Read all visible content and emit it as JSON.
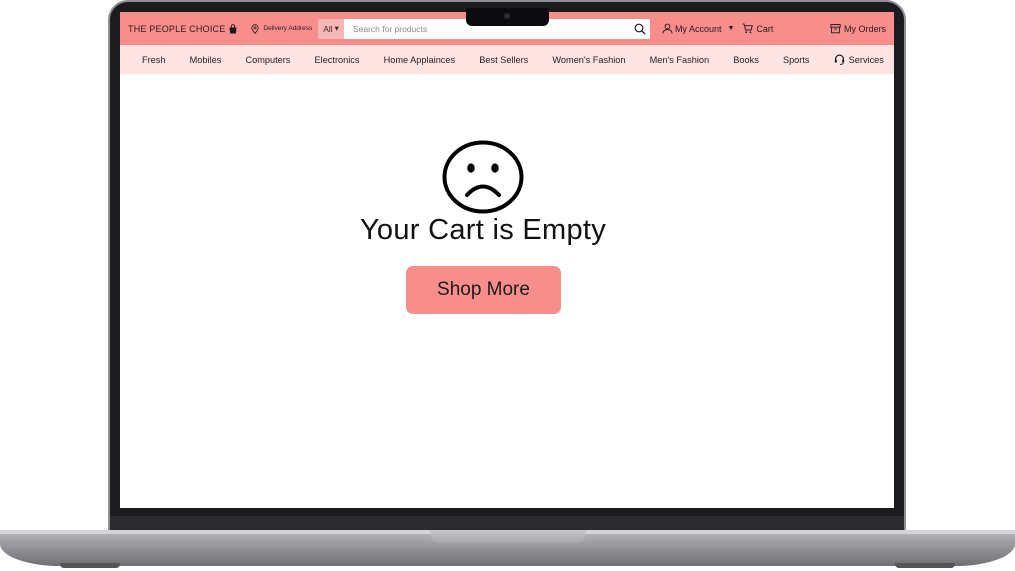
{
  "header": {
    "brand": "THE PEOPLE CHOICE",
    "delivery_label": "Delivery Address",
    "search": {
      "category": "All",
      "placeholder": "Search for products"
    },
    "account_label": "My Account",
    "cart_label": "Cart",
    "orders_label": "My Orders"
  },
  "categories": [
    "Fresh",
    "Mobiles",
    "Computers",
    "Electronics",
    "Home Applainces",
    "Best Sellers",
    "Women's Fashion",
    "Men's Fashion",
    "Books",
    "Sports"
  ],
  "services_label": "Services",
  "empty_state": {
    "title": "Your Cart is Empty",
    "button_label": "Shop More"
  },
  "colors": {
    "accent": "#f88e8b",
    "category_bar": "#fde4e3"
  },
  "icons": [
    "bag-icon",
    "location-pin-icon",
    "search-icon",
    "user-icon",
    "cart-icon",
    "orders-box-icon",
    "headset-icon",
    "sad-face-icon"
  ]
}
